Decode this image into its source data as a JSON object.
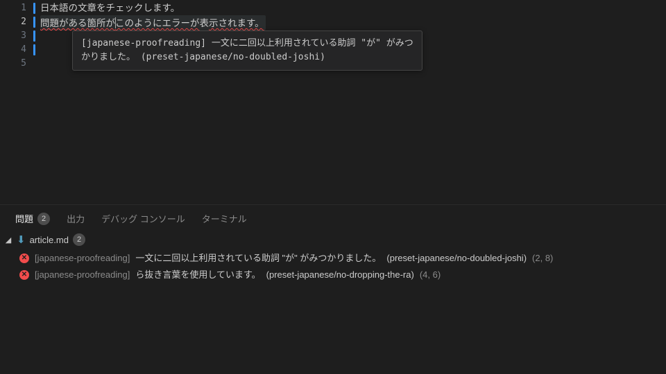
{
  "editor": {
    "lines": {
      "l1": "日本語の文章をチェックします。",
      "l2_a": "問題がある箇所が",
      "l2_b": "このようにエラーが",
      "l2_c": "表",
      "l2_d": "示されます。"
    },
    "lineNumbers": [
      "1",
      "2",
      "3",
      "4",
      "5"
    ],
    "activeLine": 2,
    "tooltip": "[japanese-proofreading] 一文に二回以上利用されている助詞 \"が\" がみつかりました。 (preset-japanese/no-doubled-joshi)"
  },
  "panel": {
    "tabs": {
      "problems": "問題",
      "problemsCount": "2",
      "output": "出力",
      "debug": "デバッグ コンソール",
      "terminal": "ターミナル"
    },
    "file": {
      "name": "article.md",
      "count": "2"
    },
    "problems": [
      {
        "source": "[japanese-proofreading]",
        "message": "一文に二回以上利用されている助詞 \"が\" がみつかりました。",
        "rule": "(preset-japanese/no-doubled-joshi)",
        "loc": "(2, 8)"
      },
      {
        "source": "[japanese-proofreading]",
        "message": "ら抜き言葉を使用しています。",
        "rule": "(preset-japanese/no-dropping-the-ra)",
        "loc": "(4, 6)"
      }
    ]
  }
}
